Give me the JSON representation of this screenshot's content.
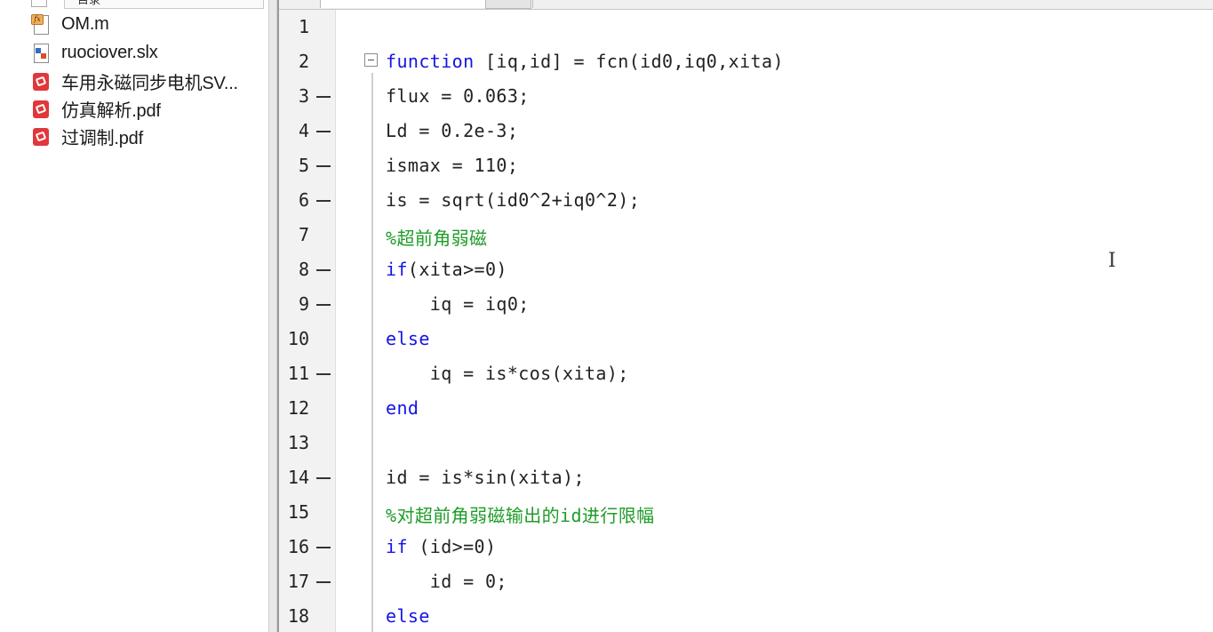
{
  "panel": {
    "header": "目录",
    "files": [
      {
        "name": "OM.m",
        "type": "m-file"
      },
      {
        "name": "ruociover.slx",
        "type": "simulink-model"
      },
      {
        "name": "车用永磁同步电机SV...",
        "type": "pdf"
      },
      {
        "name": "仿真解析.pdf",
        "type": "pdf"
      },
      {
        "name": "过调制.pdf",
        "type": "pdf"
      }
    ]
  },
  "editor": {
    "lines": [
      {
        "num": "1",
        "exec": false,
        "parts": []
      },
      {
        "num": "2",
        "exec": false,
        "parts": [
          {
            "t": "function",
            "k": "kw"
          },
          {
            "t": " [iq,id] = fcn(id0,iq0,xita)",
            "k": ""
          }
        ]
      },
      {
        "num": "3",
        "exec": true,
        "parts": [
          {
            "t": "flux = 0.063;",
            "k": ""
          }
        ]
      },
      {
        "num": "4",
        "exec": true,
        "parts": [
          {
            "t": "Ld = 0.2e-3;",
            "k": ""
          }
        ]
      },
      {
        "num": "5",
        "exec": true,
        "parts": [
          {
            "t": "ismax = 110;",
            "k": ""
          }
        ]
      },
      {
        "num": "6",
        "exec": true,
        "parts": [
          {
            "t": "is = sqrt(id0^2+iq0^2);",
            "k": ""
          }
        ]
      },
      {
        "num": "7",
        "exec": false,
        "parts": [
          {
            "t": "%超前角弱磁",
            "k": "cm"
          }
        ]
      },
      {
        "num": "8",
        "exec": true,
        "parts": [
          {
            "t": "if",
            "k": "kw"
          },
          {
            "t": "(xita>=0)",
            "k": ""
          }
        ]
      },
      {
        "num": "9",
        "exec": true,
        "parts": [
          {
            "t": "    iq = iq0;",
            "k": ""
          }
        ]
      },
      {
        "num": "10",
        "exec": false,
        "parts": [
          {
            "t": "else",
            "k": "kw"
          }
        ]
      },
      {
        "num": "11",
        "exec": true,
        "parts": [
          {
            "t": "    iq = is*cos(xita);",
            "k": ""
          }
        ]
      },
      {
        "num": "12",
        "exec": false,
        "parts": [
          {
            "t": "end",
            "k": "kw"
          }
        ]
      },
      {
        "num": "13",
        "exec": false,
        "parts": []
      },
      {
        "num": "14",
        "exec": true,
        "parts": [
          {
            "t": "id = is*sin(xita);",
            "k": ""
          }
        ]
      },
      {
        "num": "15",
        "exec": false,
        "parts": [
          {
            "t": "%对超前角弱磁输出的id进行限幅",
            "k": "cm"
          }
        ]
      },
      {
        "num": "16",
        "exec": true,
        "parts": [
          {
            "t": "if",
            "k": "kw"
          },
          {
            "t": " (id>=0)",
            "k": ""
          }
        ]
      },
      {
        "num": "17",
        "exec": true,
        "parts": [
          {
            "t": "    id = 0;",
            "k": ""
          }
        ]
      },
      {
        "num": "18",
        "exec": false,
        "parts": [
          {
            "t": "else",
            "k": "kw"
          }
        ]
      }
    ]
  },
  "cursor_glyph": "I"
}
